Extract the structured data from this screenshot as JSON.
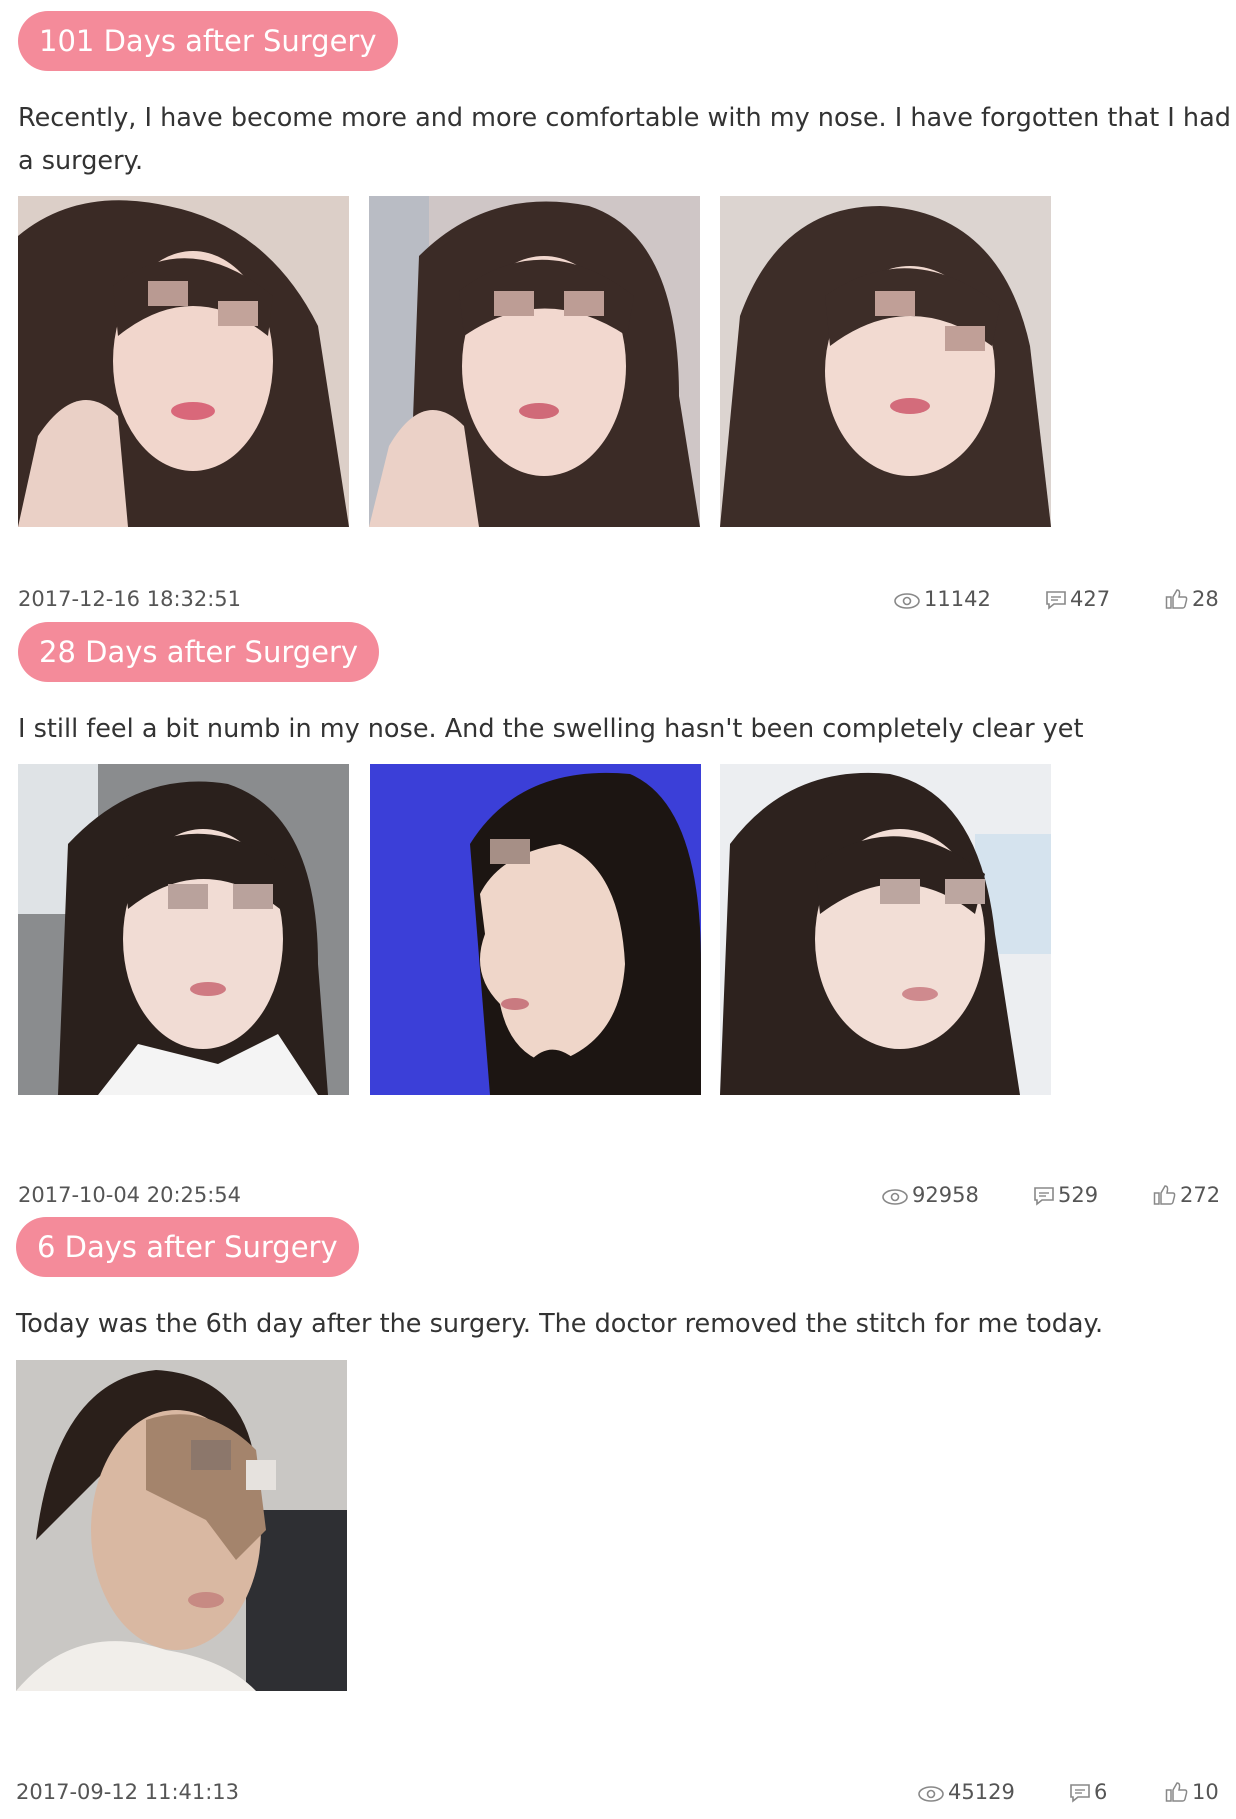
{
  "entries": [
    {
      "tag": "101 Days after Surgery",
      "text_line1": "Recently, I have become more and more comfortable with my nose. I have forgotten that I had",
      "text_line2": "a surgery.",
      "timestamp": "2017-12-16 18:32:51",
      "views": "11142",
      "comments": "427",
      "likes": "28"
    },
    {
      "tag": "28 Days after Surgery",
      "text_line1": "I still feel a bit numb in my nose. And the swelling hasn't been completely clear yet",
      "timestamp": "2017-10-04 20:25:54",
      "views": "92958",
      "comments": "529",
      "likes": "272"
    },
    {
      "tag": "6 Days after Surgery",
      "text_line1": "Today was the 6th day after the surgery. The doctor removed the stitch for me today.",
      "timestamp": "2017-09-12 11:41:13",
      "views": "45129",
      "comments": "6",
      "likes": "10"
    }
  ],
  "icons": {
    "views": "eye-icon",
    "comments": "comment-icon",
    "likes": "thumbs-up-icon"
  },
  "colors": {
    "tag_background": "#f48b9a",
    "tag_text": "#ffffff",
    "body_text": "#333333",
    "meta_text": "#555555"
  }
}
